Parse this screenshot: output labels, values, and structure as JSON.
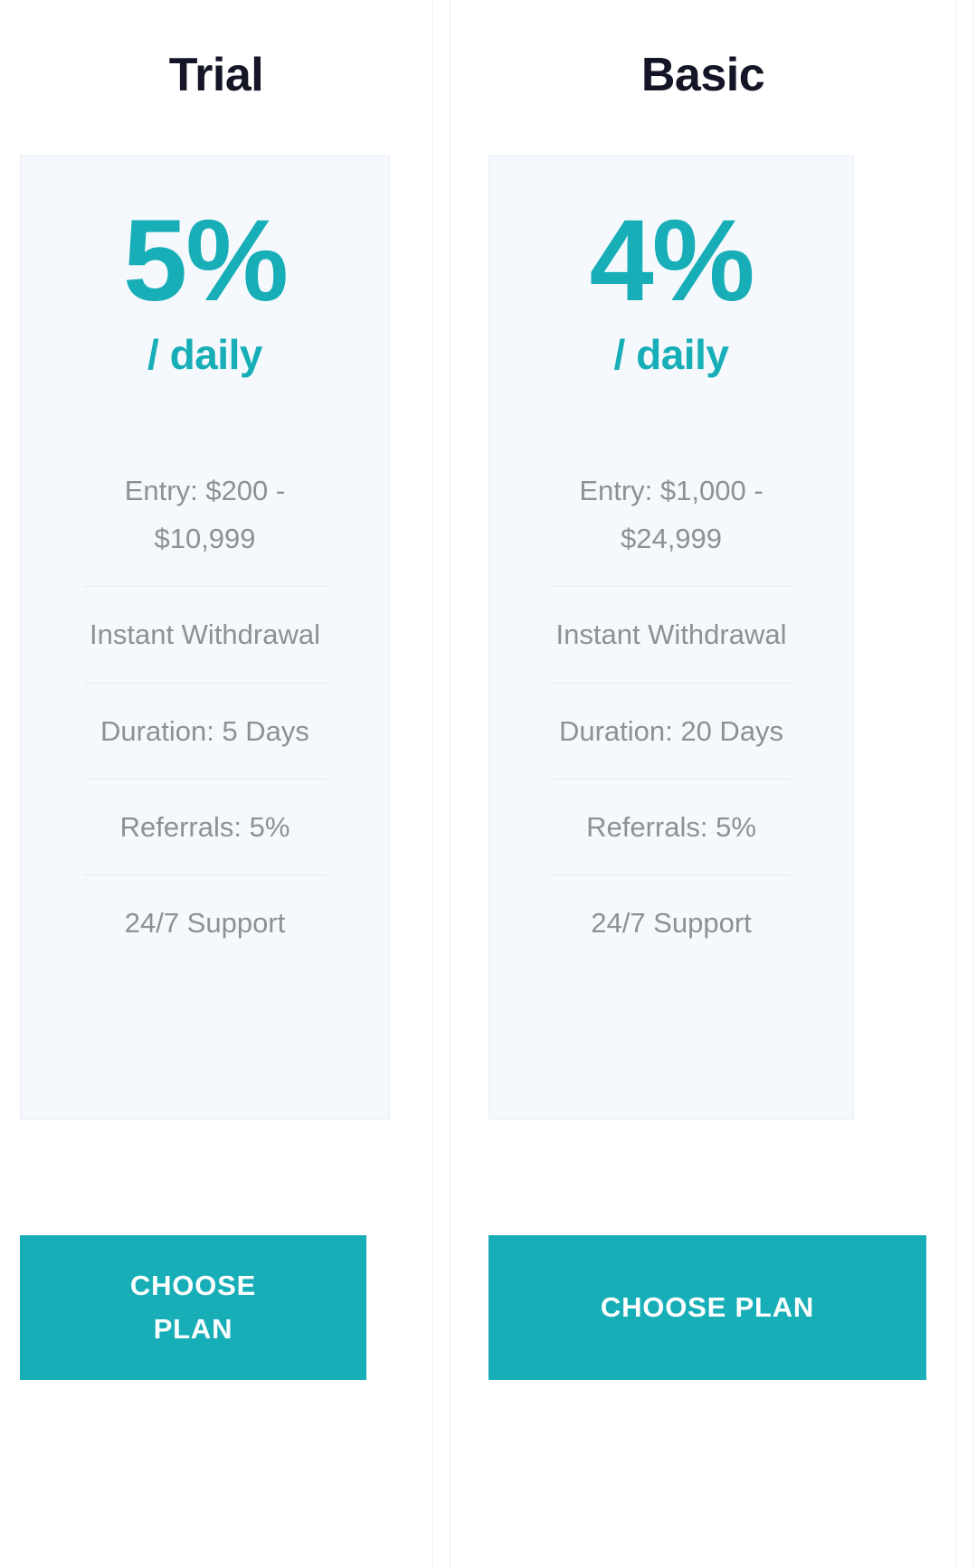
{
  "theme": {
    "accent_color": "#17aeb8",
    "card_background": "#f5f9fd",
    "title_color": "#141527",
    "feature_text_color": "#8b9196",
    "page_background": "#ffffff"
  },
  "plans": [
    {
      "title": "Trial",
      "rate_value": "5%",
      "rate_period": "/ daily",
      "features": [
        "Entry: $200 - $10,999",
        "Instant Withdrawal",
        "Duration: 5 Days",
        "Referrals: 5%",
        "24/7 Support"
      ],
      "cta_label": "CHOOSE PLAN"
    },
    {
      "title": "Basic",
      "rate_value": "4%",
      "rate_period": "/ daily",
      "features": [
        "Entry: $1,000 - $24,999",
        "Instant Withdrawal",
        "Duration: 20 Days",
        "Referrals: 5%",
        "24/7 Support"
      ],
      "cta_label": "CHOOSE PLAN"
    }
  ]
}
